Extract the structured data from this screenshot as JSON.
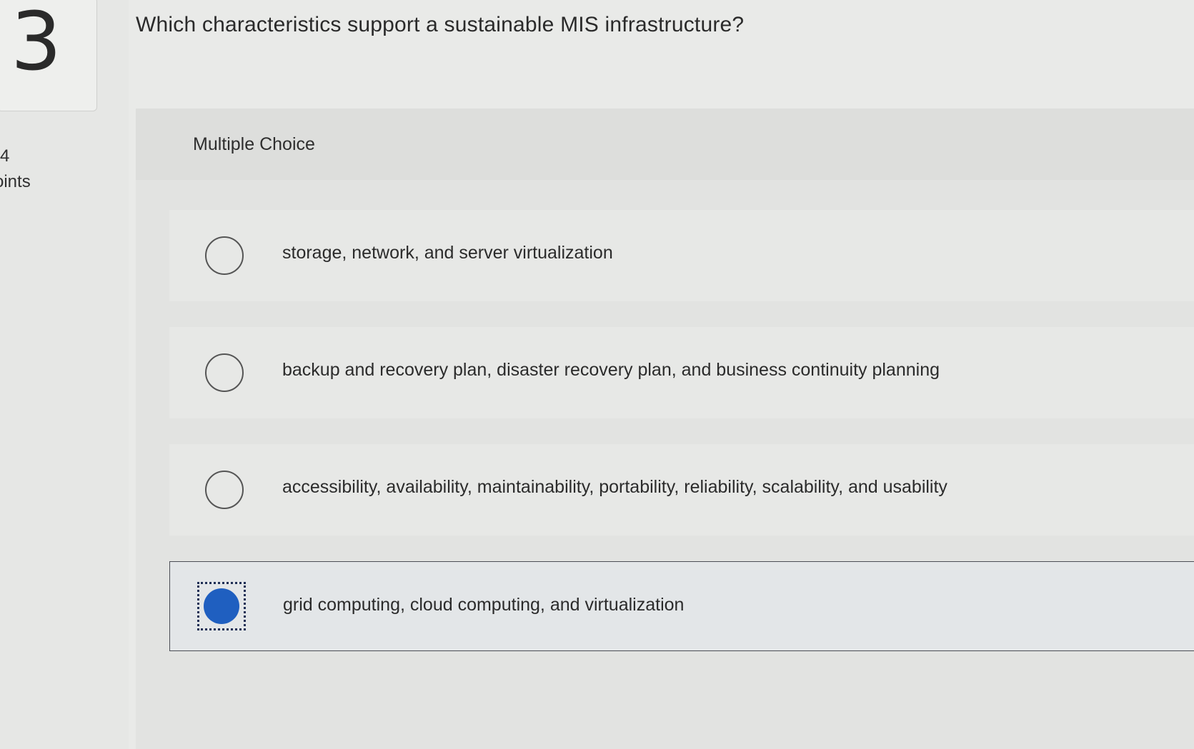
{
  "question": {
    "number": "3",
    "points_value": "4",
    "points_label": "oints",
    "prompt": "Which characteristics support a sustainable MIS infrastructure?",
    "type_label": "Multiple Choice"
  },
  "options": [
    {
      "label": "storage, network, and server virtualization",
      "selected": false
    },
    {
      "label": "backup and recovery plan, disaster recovery plan, and business continuity planning",
      "selected": false
    },
    {
      "label": "accessibility, availability, maintainability, portability, reliability, scalability, and usability",
      "selected": false
    },
    {
      "label": "grid computing, cloud computing, and virtualization",
      "selected": true
    }
  ],
  "colors": {
    "selected_radio": "#1f5fc0",
    "background": "#e9eae8"
  }
}
